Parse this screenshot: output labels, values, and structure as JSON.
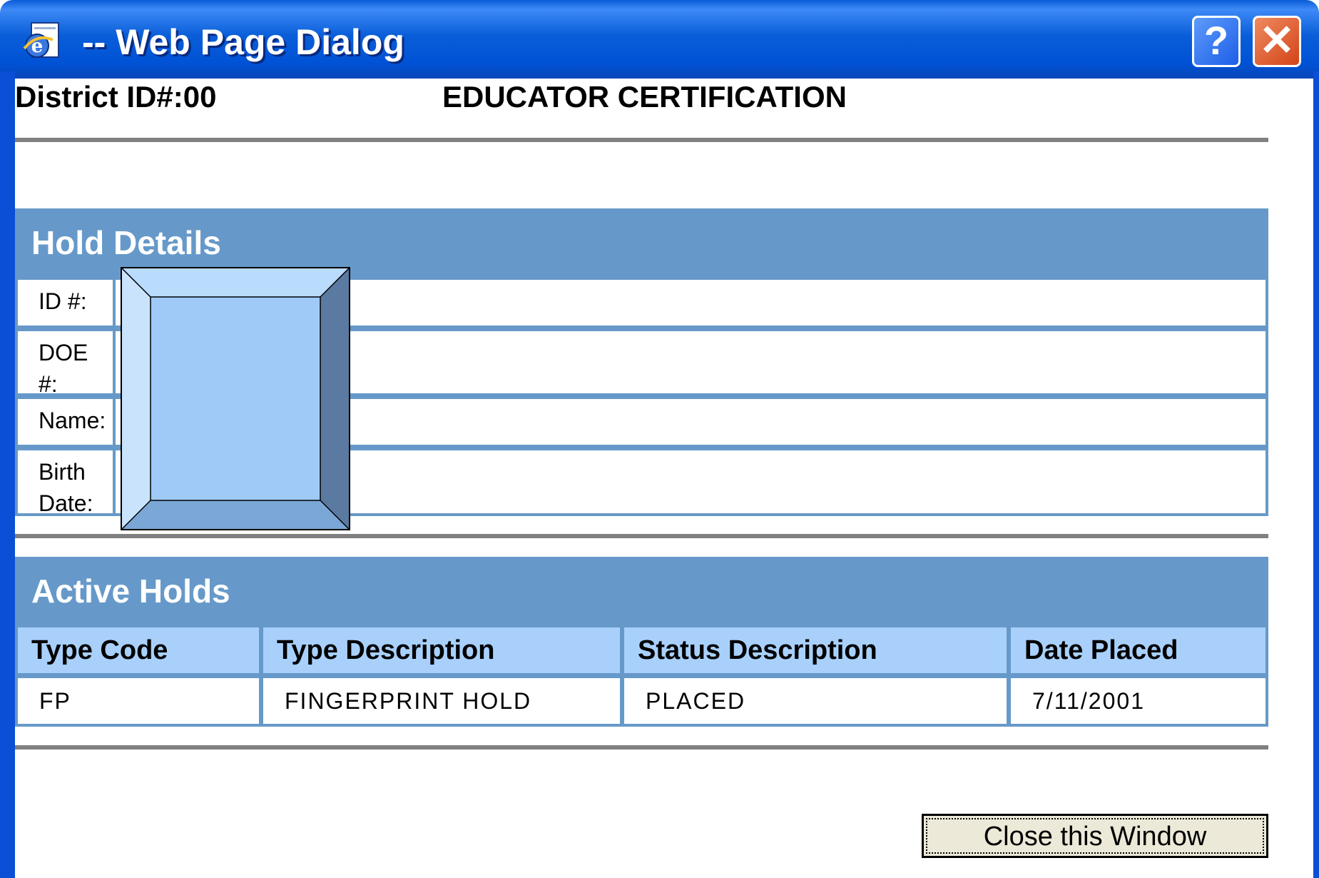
{
  "window": {
    "title": "-- Web Page Dialog",
    "help_label": "?",
    "close_label": "✕"
  },
  "header": {
    "district": "District ID#:00",
    "title": "EDUCATOR CERTIFICATION"
  },
  "hold_details": {
    "heading": "Hold Details",
    "rows": [
      {
        "label": "ID #:",
        "value": ""
      },
      {
        "label": "DOE #:",
        "value": ""
      },
      {
        "label": "Name:",
        "value": ""
      },
      {
        "label": "Birth Date:",
        "value": ""
      }
    ]
  },
  "active_holds": {
    "heading": "Active Holds",
    "columns": [
      "Type Code",
      "Type Description",
      "Status Description",
      "Date Placed"
    ],
    "rows": [
      [
        "FP",
        "FINGERPRINT HOLD",
        "PLACED",
        "7/11/2001"
      ]
    ]
  },
  "footer": {
    "close_button": "Close this Window"
  },
  "colors": {
    "titlebar": "#0a5ed8",
    "section_header": "#6699c9",
    "column_header": "#a8d0fb"
  }
}
